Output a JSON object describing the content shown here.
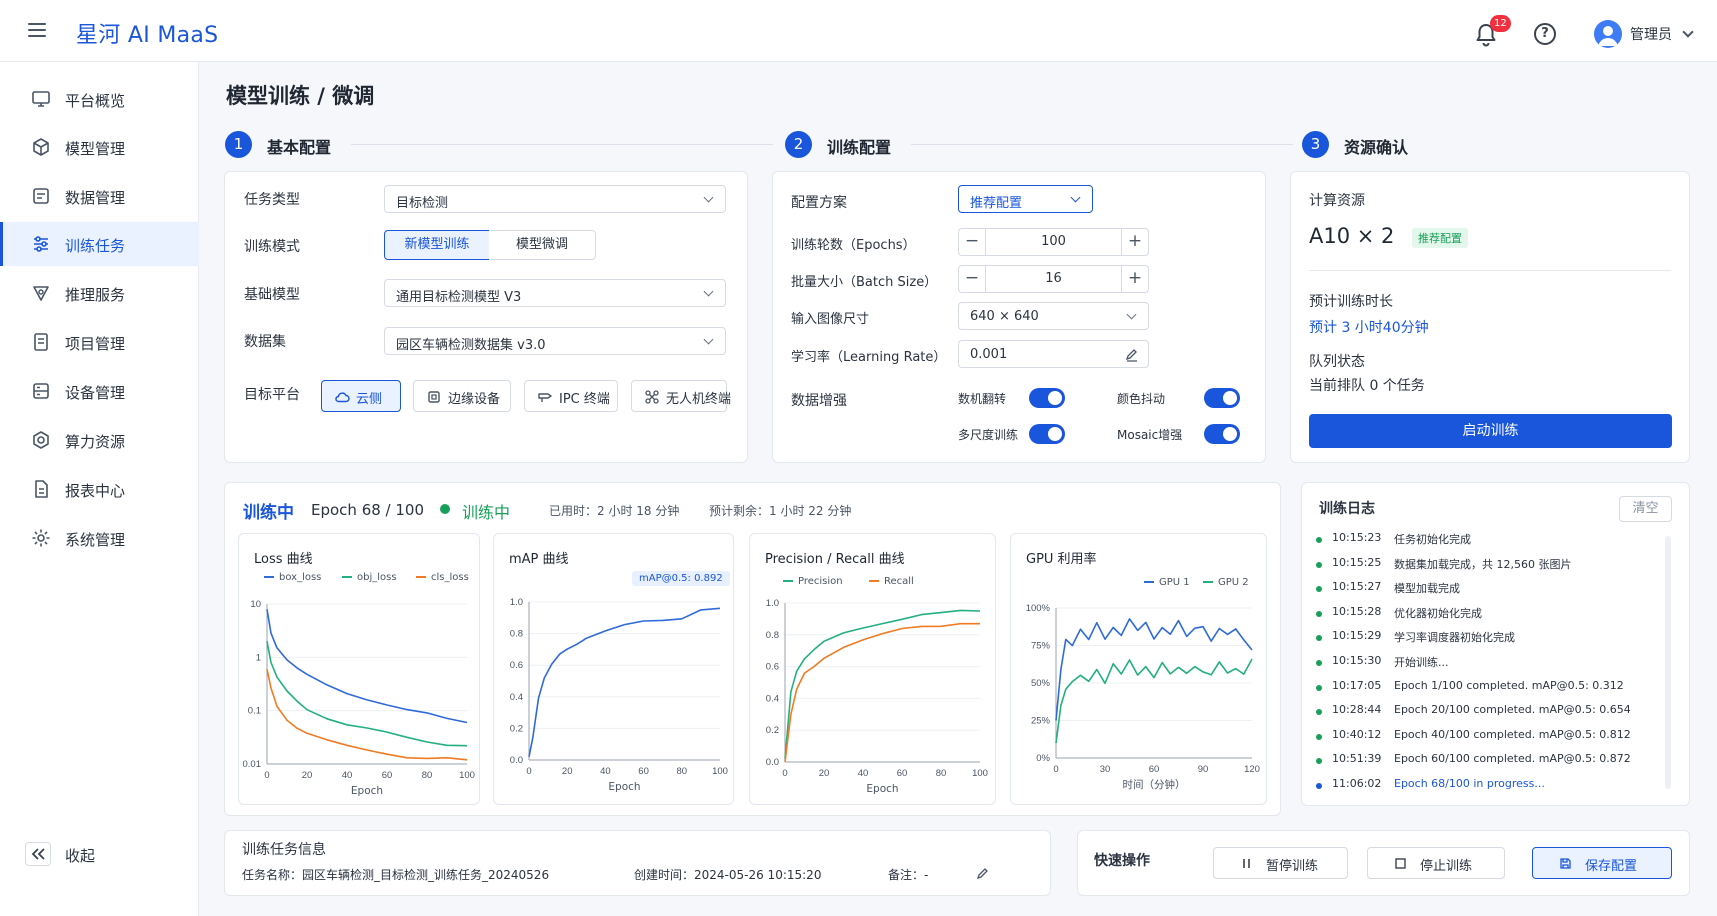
{
  "app": {
    "brand": "星河 AI MaaS"
  },
  "header": {
    "notification_count": "12",
    "user_name": "管理员"
  },
  "sidebar": {
    "items": [
      {
        "label": "平台概览",
        "icon": "monitor-icon"
      },
      {
        "label": "模型管理",
        "icon": "cube-icon"
      },
      {
        "label": "数据管理",
        "icon": "database-icon"
      },
      {
        "label": "训练任务",
        "icon": "sliders-icon",
        "active": true
      },
      {
        "label": "推理服务",
        "icon": "inference-icon"
      },
      {
        "label": "项目管理",
        "icon": "project-icon"
      },
      {
        "label": "设备管理",
        "icon": "server-icon"
      },
      {
        "label": "算力资源",
        "icon": "compute-icon"
      },
      {
        "label": "报表中心",
        "icon": "report-icon"
      },
      {
        "label": "系统管理",
        "icon": "gear-icon"
      }
    ],
    "collapse_label": "收起"
  },
  "page": {
    "title": "模型训练 / 微调"
  },
  "steps": [
    {
      "num": "1",
      "title": "基本配置"
    },
    {
      "num": "2",
      "title": "训练配置"
    },
    {
      "num": "3",
      "title": "资源确认"
    }
  ],
  "basic": {
    "task_type_label": "任务类型",
    "task_type_value": "目标检测",
    "mode_label": "训练模式",
    "mode_options": [
      "新模型训练",
      "模型微调"
    ],
    "base_model_label": "基础模型",
    "base_model_value": "通用目标检测模型 V3",
    "dataset_label": "数据集",
    "dataset_value": "园区车辆检测数据集 v3.0",
    "platform_label": "目标平台",
    "platforms": [
      "云侧",
      "边缘设备",
      "IPC 终端",
      "无人机终端"
    ]
  },
  "train_cfg": {
    "scheme_label": "配置方案",
    "scheme_value": "推荐配置",
    "epochs_label": "训练轮数（Epochs）",
    "epochs_value": "100",
    "batch_label": "批量大小（Batch Size）",
    "batch_value": "16",
    "imgsize_label": "输入图像尺寸",
    "imgsize_value": "640 × 640",
    "lr_label": "学习率（Learning Rate）",
    "lr_value": "0.001",
    "aug_label": "数据增强",
    "aug": [
      {
        "label": "数机翻转",
        "on": true
      },
      {
        "label": "颜色抖动",
        "on": true
      },
      {
        "label": "多尺度训练",
        "on": true
      },
      {
        "label": "Mosaic增强",
        "on": true
      }
    ]
  },
  "resource": {
    "compute_label": "计算资源",
    "compute_value": "A10 × 2",
    "compute_badge": "推荐配置",
    "duration_label": "预计训练时长",
    "duration_value": "预计 3 小时40分钟",
    "queue_label": "队列状态",
    "queue_value": "当前排队 0 个任务",
    "start_button": "启动训练"
  },
  "progress": {
    "status_title": "训练中",
    "epoch_text": "Epoch 68 / 100",
    "status_badge": "训练中",
    "elapsed": "已用时：2 小时 18 分钟",
    "remaining": "预计剩余：1 小时 22 分钟"
  },
  "chart_data": [
    {
      "type": "line",
      "title": "Loss 曲线",
      "xlabel": "Epoch",
      "ylabel": "",
      "yscale": "log",
      "ylim": [
        0.01,
        10
      ],
      "xlim": [
        0,
        100
      ],
      "xticks": [
        "0",
        "20",
        "40",
        "60",
        "80",
        "100"
      ],
      "yticks": [
        "10",
        "1",
        "0.1",
        "0.01"
      ],
      "x": [
        0,
        2,
        5,
        10,
        15,
        20,
        30,
        40,
        50,
        60,
        70,
        80,
        90,
        100
      ],
      "series": [
        {
          "name": "box_loss",
          "color": "#2f6ad9",
          "values": [
            8,
            3,
            1.6,
            0.9,
            0.6,
            0.45,
            0.3,
            0.22,
            0.17,
            0.13,
            0.1,
            0.085,
            0.07,
            0.06
          ]
        },
        {
          "name": "obj_loss",
          "color": "#22b07d",
          "values": [
            2,
            0.8,
            0.4,
            0.22,
            0.15,
            0.11,
            0.075,
            0.055,
            0.045,
            0.037,
            0.031,
            0.027,
            0.024,
            0.022
          ]
        },
        {
          "name": "cls_loss",
          "color": "#f07b22",
          "values": [
            0.6,
            0.25,
            0.12,
            0.07,
            0.05,
            0.038,
            0.027,
            0.021,
            0.018,
            0.016,
            0.014,
            0.013,
            0.0125,
            0.012
          ]
        }
      ]
    },
    {
      "type": "line",
      "title": "mAP 曲线",
      "xlabel": "Epoch",
      "ylabel": "",
      "annotation": "mAP@0.5: 0.892",
      "ylim": [
        0,
        1
      ],
      "xlim": [
        0,
        100
      ],
      "xticks": [
        "0",
        "20",
        "40",
        "60",
        "80",
        "100"
      ],
      "yticks": [
        "1.0",
        "0.8",
        "0.6",
        "0.4",
        "0.2",
        "0.0"
      ],
      "x": [
        0,
        2,
        5,
        8,
        12,
        16,
        20,
        25,
        30,
        40,
        50,
        60,
        70,
        80,
        90,
        100
      ],
      "series": [
        {
          "name": "mAP@0.5",
          "color": "#2f6ad9",
          "values": [
            0.02,
            0.15,
            0.4,
            0.52,
            0.6,
            0.66,
            0.7,
            0.74,
            0.78,
            0.82,
            0.85,
            0.87,
            0.88,
            0.9,
            0.96,
            0.96
          ]
        }
      ]
    },
    {
      "type": "line",
      "title": "Precision / Recall 曲线",
      "xlabel": "Epoch",
      "ylabel": "",
      "ylim": [
        0,
        1
      ],
      "xlim": [
        0,
        100
      ],
      "xticks": [
        "0",
        "20",
        "40",
        "60",
        "80",
        "100"
      ],
      "yticks": [
        "1.0",
        "0.8",
        "0.6",
        "0.4",
        "0.2",
        "0.0"
      ],
      "x": [
        0,
        3,
        6,
        10,
        15,
        20,
        30,
        40,
        50,
        60,
        70,
        80,
        90,
        100
      ],
      "series": [
        {
          "name": "Precision",
          "color": "#22b07d",
          "values": [
            0.02,
            0.45,
            0.58,
            0.65,
            0.7,
            0.75,
            0.81,
            0.85,
            0.88,
            0.9,
            0.92,
            0.93,
            0.95,
            0.95
          ]
        },
        {
          "name": "Recall",
          "color": "#f07b22",
          "values": [
            0.0,
            0.3,
            0.45,
            0.55,
            0.6,
            0.66,
            0.73,
            0.77,
            0.8,
            0.83,
            0.85,
            0.86,
            0.88,
            0.87
          ]
        }
      ]
    },
    {
      "type": "line",
      "title": "GPU 利用率",
      "xlabel": "时间（分钟）",
      "ylabel": "",
      "ylim": [
        0,
        100
      ],
      "xlim": [
        0,
        120
      ],
      "xticks": [
        "0",
        "30",
        "60",
        "90",
        "120"
      ],
      "yticks": [
        "100%",
        "75%",
        "50%",
        "25%",
        "0%"
      ],
      "x": [
        0,
        3,
        6,
        10,
        15,
        20,
        25,
        30,
        35,
        40,
        45,
        50,
        55,
        60,
        65,
        70,
        75,
        80,
        85,
        90,
        95,
        100,
        105,
        110,
        115,
        120
      ],
      "series": [
        {
          "name": "GPU 1",
          "color": "#2f6ad9",
          "values": [
            25,
            60,
            80,
            75,
            85,
            78,
            90,
            80,
            88,
            82,
            92,
            84,
            90,
            80,
            88,
            83,
            91,
            80,
            86,
            88,
            79,
            87,
            82,
            85,
            78,
            72
          ]
        },
        {
          "name": "GPU 2",
          "color": "#22b07d",
          "values": [
            10,
            35,
            45,
            50,
            55,
            52,
            60,
            50,
            62,
            55,
            65,
            56,
            62,
            54,
            63,
            55,
            60,
            57,
            62,
            58,
            55,
            63,
            56,
            60,
            57,
            66
          ]
        }
      ]
    }
  ],
  "log": {
    "title": "训练日志",
    "clear_button": "清空",
    "entries": [
      {
        "time": "10:15:23",
        "msg": "任务初始化完成"
      },
      {
        "time": "10:15:25",
        "msg": "数据集加载完成，共 12,560 张图片"
      },
      {
        "time": "10:15:27",
        "msg": "模型加载完成"
      },
      {
        "time": "10:15:28",
        "msg": "优化器初始化完成"
      },
      {
        "time": "10:15:29",
        "msg": "学习率调度器初始化完成"
      },
      {
        "time": "10:15:30",
        "msg": "开始训练..."
      },
      {
        "time": "10:17:05",
        "msg": "Epoch 1/100 completed. mAP@0.5: 0.312"
      },
      {
        "time": "10:28:44",
        "msg": "Epoch 20/100 completed. mAP@0.5: 0.654"
      },
      {
        "time": "10:40:12",
        "msg": "Epoch 40/100 completed. mAP@0.5: 0.812"
      },
      {
        "time": "10:51:39",
        "msg": "Epoch 60/100 completed. mAP@0.5: 0.872"
      },
      {
        "time": "11:06:02",
        "msg": "Epoch 68/100 in progress...",
        "active": true
      }
    ]
  },
  "task_info": {
    "title": "训练任务信息",
    "name": "任务名称：园区车辆检测_目标检测_训练任务_20240526",
    "created": "创建时间：2024-05-26 10:15:20",
    "note": "备注：-"
  },
  "quick": {
    "title": "快速操作",
    "pause": "暂停训练",
    "stop": "停止训练",
    "save": "保存配置"
  },
  "colors": {
    "primary": "#1a56db",
    "success": "#18a058",
    "badge": "#f0303e"
  }
}
